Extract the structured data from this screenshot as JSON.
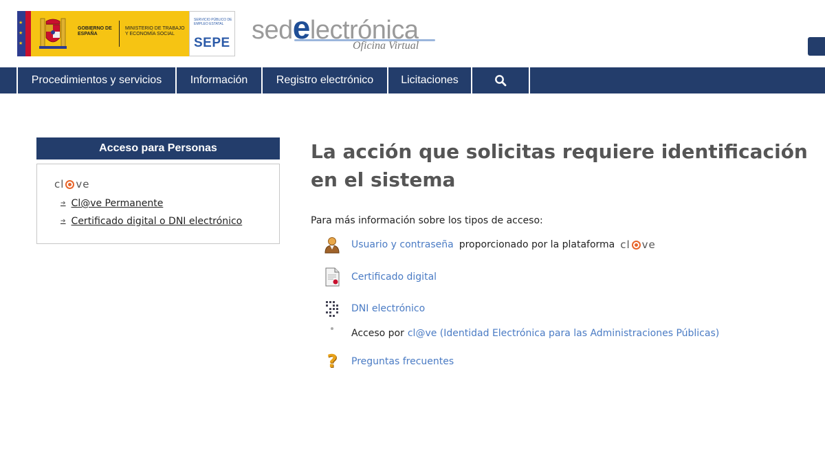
{
  "header": {
    "gov_text": "GOBIERNO DE ESPAÑA",
    "ministry_text": "MINISTERIO DE TRABAJO Y ECONOMÍA SOCIAL",
    "sepe_small": "SERVICIO PÚBLICO DE EMPLEO ESTATAL",
    "sepe_big": "SEPE",
    "sede_prefix": "sed",
    "sede_e": "e",
    "sede_suffix": "lectrónica",
    "sede_sub": "Oficina Virtual"
  },
  "nav": {
    "items": [
      {
        "label": "Procedimientos y servicios"
      },
      {
        "label": "Información"
      },
      {
        "label": "Registro electrónico"
      },
      {
        "label": "Licitaciones"
      }
    ],
    "search_icon": "search-icon"
  },
  "sidebar": {
    "title": "Acceso para Personas",
    "clave_logo": {
      "pre": "cl",
      "post": "ve"
    },
    "links": [
      {
        "label": "Cl@ve Permanente"
      },
      {
        "label": "Certificado digital o DNI electrónico"
      }
    ]
  },
  "main": {
    "title": "La acción que solicitas requiere identificación en el sistema",
    "intro": "Para más información sobre los tipos de acceso:",
    "access": [
      {
        "link": "Usuario y contraseña",
        "text": "proporcionado por la plataforma",
        "icon": "user-icon"
      },
      {
        "link": "Certificado digital",
        "icon": "certificate-icon"
      },
      {
        "link": "DNI electrónico",
        "icon": "dni-chip-icon"
      },
      {
        "text": "Acceso por",
        "link": "cl@ve (Identidad Electrónica para las Administraciones Públicas)",
        "icon": "bullet-icon"
      },
      {
        "link": "Preguntas frecuentes",
        "icon": "question-icon"
      }
    ]
  },
  "colors": {
    "nav_bg": "#233d6b",
    "link": "#4a7bc4",
    "clave_orange": "#e8652a",
    "gov_yellow": "#f6c413"
  }
}
